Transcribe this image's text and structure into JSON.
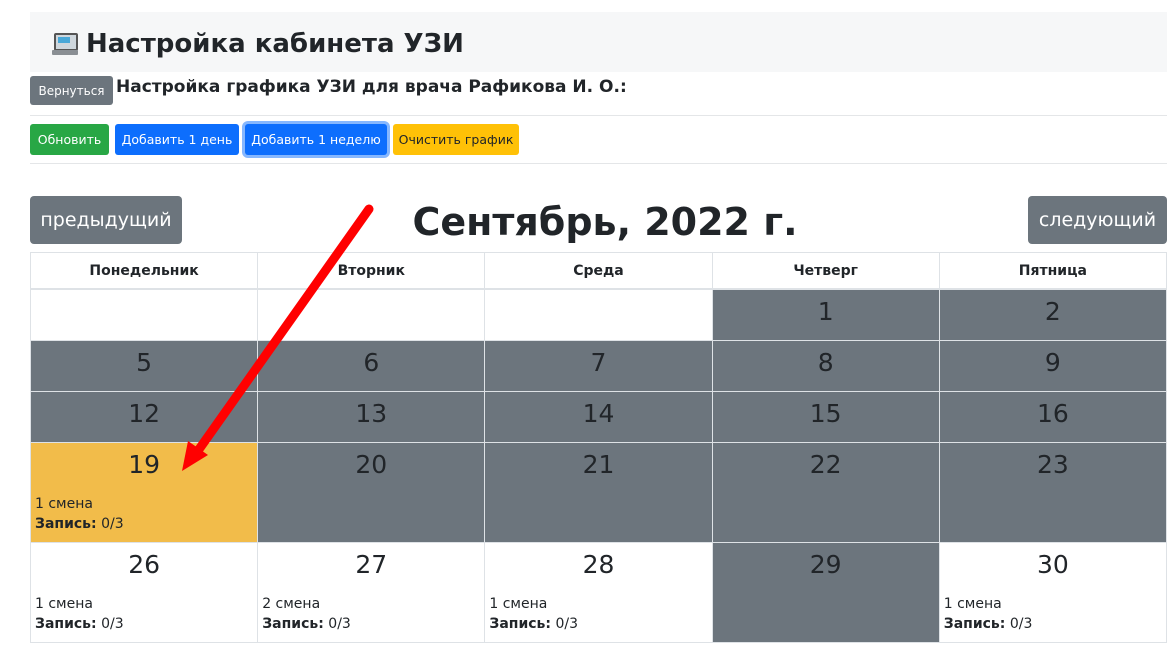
{
  "header": {
    "title": "Настройка кабинета УЗИ",
    "icon": "computer-icon"
  },
  "sub": {
    "back_label": "Вернуться",
    "doctor_text": "Настройка графика УЗИ для врача Рафикова И. О.:"
  },
  "toolbar": {
    "refresh_label": "Обновить",
    "add_day_label": "Добавить 1 день",
    "add_week_label": "Добавить 1 неделю",
    "clear_label": "Очистить график"
  },
  "calendar": {
    "month_title": "Сентябрь, 2022 г.",
    "prev_label": "предыдущий",
    "next_label": "следующий",
    "weekdays": [
      "Понедельник",
      "Вторник",
      "Среда",
      "Четверг",
      "Пятница"
    ],
    "record_label": "Запись:",
    "weeks": [
      [
        {
          "day": "",
          "state": "white"
        },
        {
          "day": "",
          "state": "white"
        },
        {
          "day": "",
          "state": "white"
        },
        {
          "day": "1",
          "state": "gray"
        },
        {
          "day": "2",
          "state": "gray"
        }
      ],
      [
        {
          "day": "5",
          "state": "gray"
        },
        {
          "day": "6",
          "state": "gray"
        },
        {
          "day": "7",
          "state": "gray"
        },
        {
          "day": "8",
          "state": "gray"
        },
        {
          "day": "9",
          "state": "gray"
        }
      ],
      [
        {
          "day": "12",
          "state": "gray"
        },
        {
          "day": "13",
          "state": "gray"
        },
        {
          "day": "14",
          "state": "gray"
        },
        {
          "day": "15",
          "state": "gray"
        },
        {
          "day": "16",
          "state": "gray"
        }
      ],
      [
        {
          "day": "19",
          "state": "yellow",
          "shift": "1 смена",
          "record": "0/3"
        },
        {
          "day": "20",
          "state": "gray"
        },
        {
          "day": "21",
          "state": "gray"
        },
        {
          "day": "22",
          "state": "gray"
        },
        {
          "day": "23",
          "state": "gray"
        }
      ],
      [
        {
          "day": "26",
          "state": "white",
          "shift": "1 смена",
          "record": "0/3"
        },
        {
          "day": "27",
          "state": "white",
          "shift": "2 смена",
          "record": "0/3"
        },
        {
          "day": "28",
          "state": "white",
          "shift": "1 смена",
          "record": "0/3"
        },
        {
          "day": "29",
          "state": "gray"
        },
        {
          "day": "30",
          "state": "white",
          "shift": "1 смена",
          "record": "0/3"
        }
      ]
    ]
  },
  "colors": {
    "gray": "#6c757d",
    "yellow": "#f2bc4a",
    "arrow": "#ff0000"
  }
}
